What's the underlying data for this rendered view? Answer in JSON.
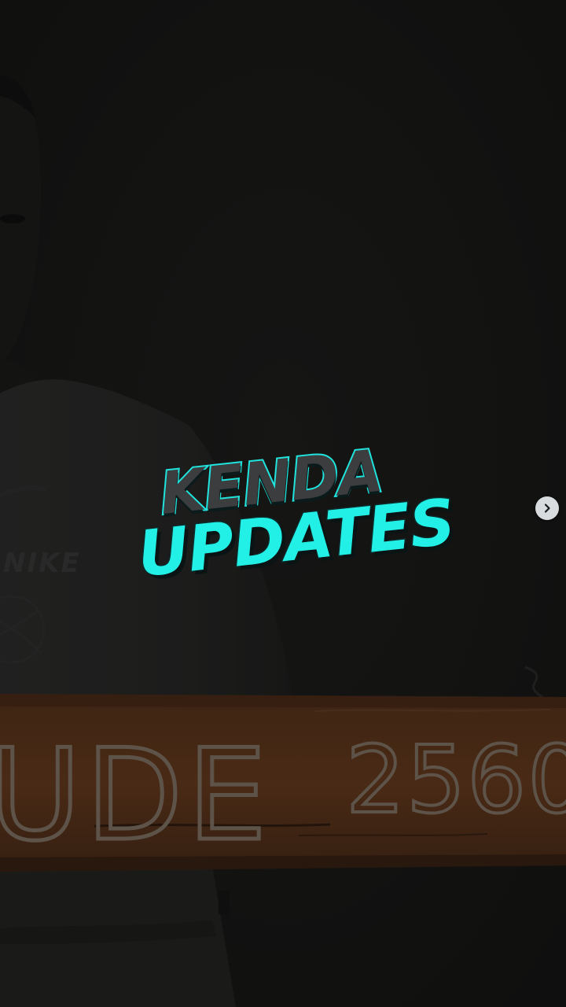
{
  "story": {
    "title_line_1": "KENDA",
    "title_line_2": "UPDATES",
    "shirt_brand": "NIKE",
    "sign_text": "UDE",
    "sign_number": "2560"
  },
  "navigation": {
    "next_icon": "chevron-right-icon"
  },
  "colors": {
    "background": "#141413",
    "accent_cyan": "#22f0e6",
    "title_dark": "#3b3d3f",
    "sign_orange": "#6a3a1c",
    "button_bg": "#d9dcdf"
  }
}
